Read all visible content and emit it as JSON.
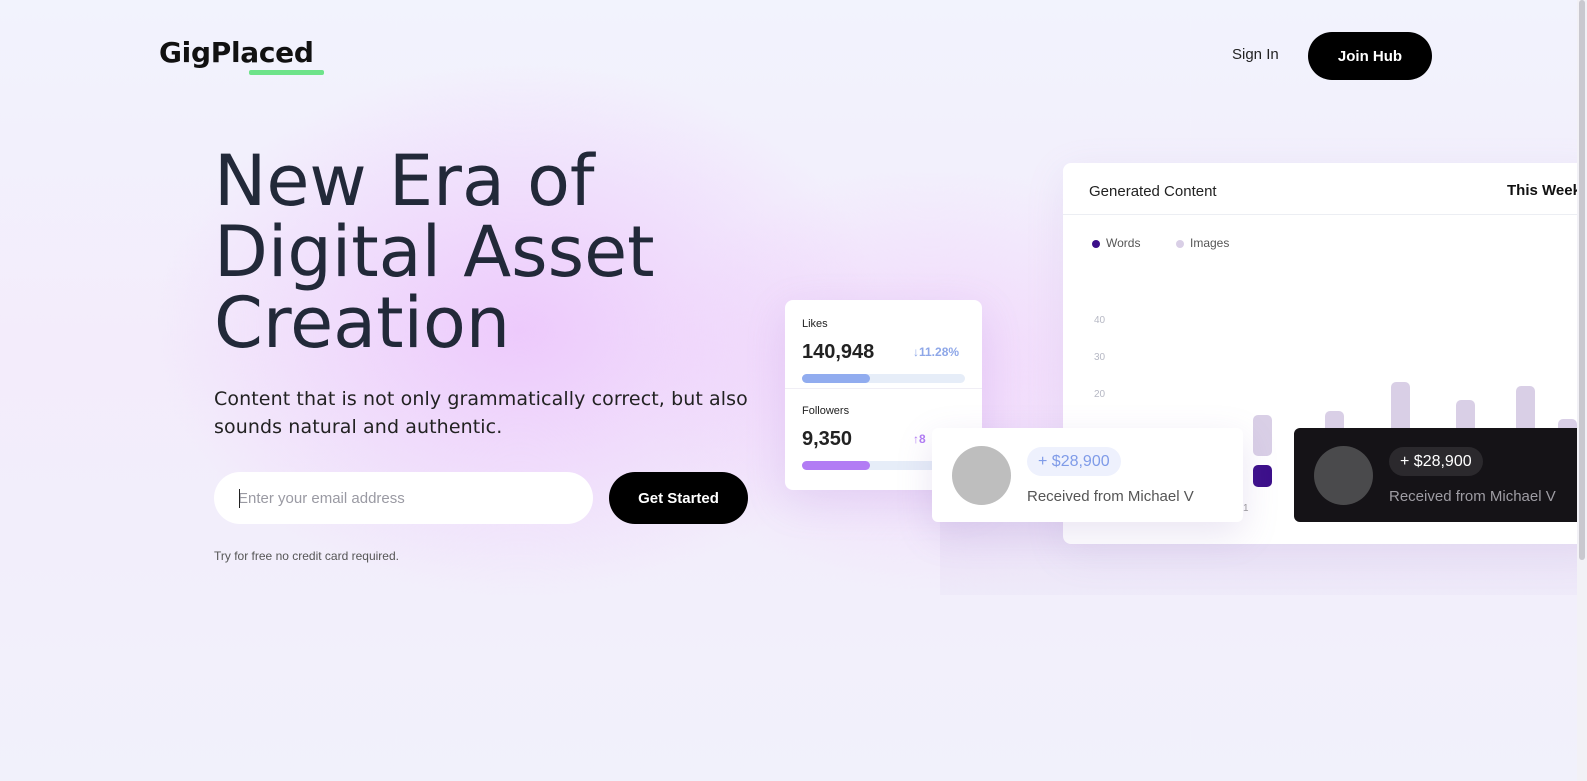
{
  "header": {
    "logo": "GigPlaced",
    "sign_in": "Sign In",
    "join_hub": "Join Hub"
  },
  "hero": {
    "title_lines": [
      "New Era of",
      "Digital Asset",
      "Creation"
    ],
    "subtitle_line1": "Content that is not only grammatically correct, but also",
    "subtitle_line2": "sounds natural and authentic.",
    "email_placeholder": "Enter your email address",
    "cta": "Get Started",
    "note": "Try for free no credit card required."
  },
  "panel": {
    "title": "Generated Content",
    "period": "This Week",
    "legend": [
      {
        "label": "Words",
        "color": "#3c0f8a"
      },
      {
        "label": "Images",
        "color": "#d9cfe6"
      }
    ],
    "y_ticks": [
      "40",
      "30",
      "20"
    ],
    "x_tick_visible": "1"
  },
  "stats": {
    "likes": {
      "label": "Likes",
      "value": "140,948",
      "change": "11.28%",
      "direction": "down",
      "progress": 0.42,
      "color": "#91acef"
    },
    "followers": {
      "label": "Followers",
      "value": "9,350",
      "change": "8",
      "direction": "up",
      "progress": 0.42,
      "color": "#b27cf4"
    }
  },
  "payments": {
    "light": {
      "amount": "+ $28,900",
      "text": "Received from Michael V"
    },
    "dark": {
      "amount": "+ $28,900",
      "text": "Received from Michael V"
    }
  },
  "chart_data": {
    "type": "bar",
    "title": "Generated Content",
    "series": [
      {
        "name": "Words",
        "values": [
          6,
          6,
          11,
          11,
          6,
          5
        ]
      },
      {
        "name": "Images",
        "values": [
          11,
          12,
          15,
          10,
          19,
          11
        ]
      }
    ],
    "note": "Stacked bars partially hidden behind overlay cards; visible columns only"
  }
}
